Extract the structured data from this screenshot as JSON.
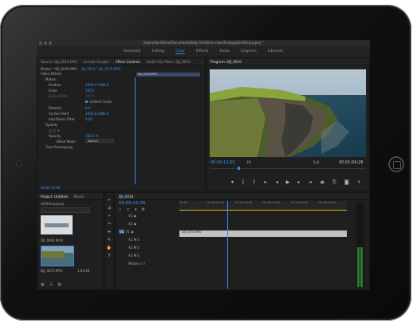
{
  "app": {
    "path": "/Users/davidhme/Documents/Kelly OneDrive class/Footage/Untitled.prproj *",
    "workspaces": [
      "Assembly",
      "Editing",
      "Color",
      "Effects",
      "Audio",
      "Graphics",
      "Libraries"
    ],
    "active_workspace": "Color"
  },
  "source_panel": {
    "tabs": [
      "Source: DJI_0010.MP4",
      "Lumetri Scopes",
      "Effect Controls",
      "Audio Clip Mixer: DJI_0010"
    ],
    "active_tab": "Effect Controls",
    "master_label": "Master * DJI_0010.MP4",
    "sequence_label": "DJI_0010 * DJI_0070.MP4",
    "section": "Video Effects",
    "clip_bar": "DJI_0070.MP4",
    "params": [
      {
        "name": "Motion",
        "value": ""
      },
      {
        "name": "Position",
        "value": "1920.0   1080.0"
      },
      {
        "name": "Scale",
        "value": "100.0"
      },
      {
        "name": "Scale Width",
        "value": "100.0"
      },
      {
        "name": "Uniform Scale",
        "value": "Uniform Scale"
      },
      {
        "name": "Rotation",
        "value": "0.0"
      },
      {
        "name": "Anchor Point",
        "value": "1920.0   1080.0"
      },
      {
        "name": "Anti-flicker Filter",
        "value": "0.00"
      },
      {
        "name": "Opacity",
        "value": ""
      },
      {
        "name": "Opacity",
        "value": "100.0 %"
      },
      {
        "name": "Blend Mode",
        "value": "Normal"
      },
      {
        "name": "Time Remapping",
        "value": ""
      }
    ],
    "timecode": "00:00:12:05"
  },
  "program": {
    "title": "Program: DJI_0010",
    "timecode": "00:00:12:05",
    "fit": "Fit",
    "quality": "Full",
    "duration": "00:01:04:26"
  },
  "project": {
    "tabs": [
      "Project: Untitled",
      "Media"
    ],
    "file": "Untitled.prproj",
    "search_placeholder": "",
    "items": [
      {
        "name": "DJI_0004.MOV",
        "duration": "5:00"
      },
      {
        "name": "DJI_0070.MP4",
        "duration": "1:04:26"
      }
    ]
  },
  "timeline": {
    "tab": "DJI_0010",
    "timecode": "00:00:12:05",
    "ruler": [
      "00:00",
      "00:00:05:00",
      "00:00:10:00",
      "00:00:15:00",
      "00:00:20:00",
      "00:00:25:00"
    ],
    "tracks": [
      "V3",
      "V2",
      "V1",
      "A1",
      "A2",
      "A3"
    ],
    "clip_name": "DJI_0070.MP4",
    "master_label": "Master",
    "master_value": "0.0"
  },
  "colors": {
    "accent": "#2d8ceb",
    "yellow": "#e0c020"
  }
}
